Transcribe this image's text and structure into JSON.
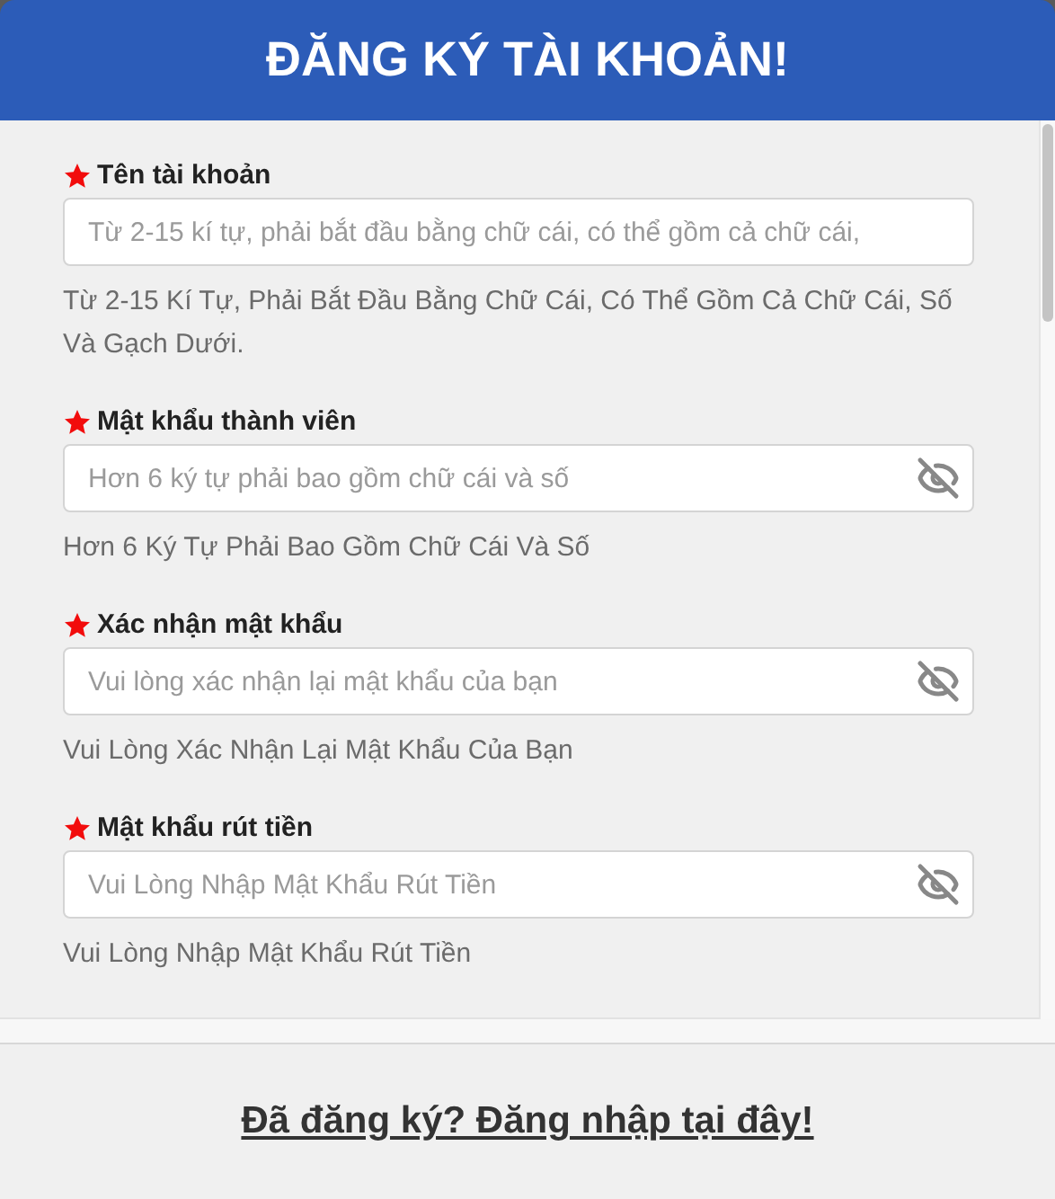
{
  "header": {
    "title": "ĐĂNG KÝ TÀI KHOẢN!"
  },
  "fields": [
    {
      "kind": "text",
      "required": true,
      "label": "Tên tài khoản",
      "placeholder": "Từ 2-15 kí tự, phải bắt đầu bằng chữ cái, có thể gồm cả chữ cái,",
      "help": "Từ 2-15 Kí Tự, Phải Bắt Đầu Bằng Chữ Cái, Có Thể Gồm Cả Chữ Cái, Số Và Gạch Dưới."
    },
    {
      "kind": "password",
      "required": true,
      "label": "Mật khẩu thành viên",
      "placeholder": "Hơn 6 ký tự phải bao gồm chữ cái và số",
      "help": "Hơn 6 Ký Tự Phải Bao Gồm Chữ Cái Và Số"
    },
    {
      "kind": "password",
      "required": true,
      "label": "Xác nhận mật khẩu",
      "placeholder": "Vui lòng xác nhận lại mật khẩu của bạn",
      "help": "Vui Lòng Xác Nhận Lại Mật Khẩu Của Bạn"
    },
    {
      "kind": "password",
      "required": true,
      "label": "Mật khẩu rút tiền",
      "placeholder": "Vui Lòng Nhập Mật Khẩu Rút Tiền",
      "help": "Vui Lòng Nhập Mật Khẩu Rút Tiền"
    }
  ],
  "footer": {
    "link": "Đã đăng ký? Đăng nhập tại đây!"
  }
}
